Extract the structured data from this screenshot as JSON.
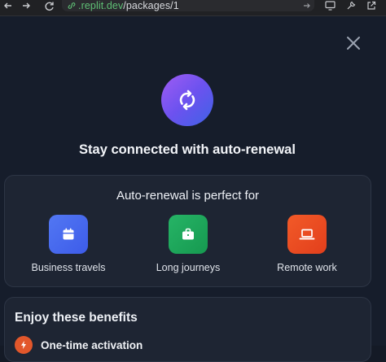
{
  "browser": {
    "url_prefix": ".replit.dev",
    "url_path": "/packages/1"
  },
  "modal": {
    "title": "Stay connected with auto-renewal",
    "perfect_for": {
      "title": "Auto-renewal is perfect for",
      "items": [
        {
          "label": "Business travels",
          "icon": "calendar-icon",
          "color": "#4a6cf0"
        },
        {
          "label": "Long journeys",
          "icon": "briefcase-icon",
          "color": "#1fa65a"
        },
        {
          "label": "Remote work",
          "icon": "laptop-icon",
          "color": "#ee4f22"
        }
      ]
    },
    "benefits": {
      "title": "Enjoy these benefits",
      "items": [
        {
          "label": "One-time activation",
          "icon": "bolt-icon",
          "color": "#e2572b"
        }
      ]
    }
  }
}
